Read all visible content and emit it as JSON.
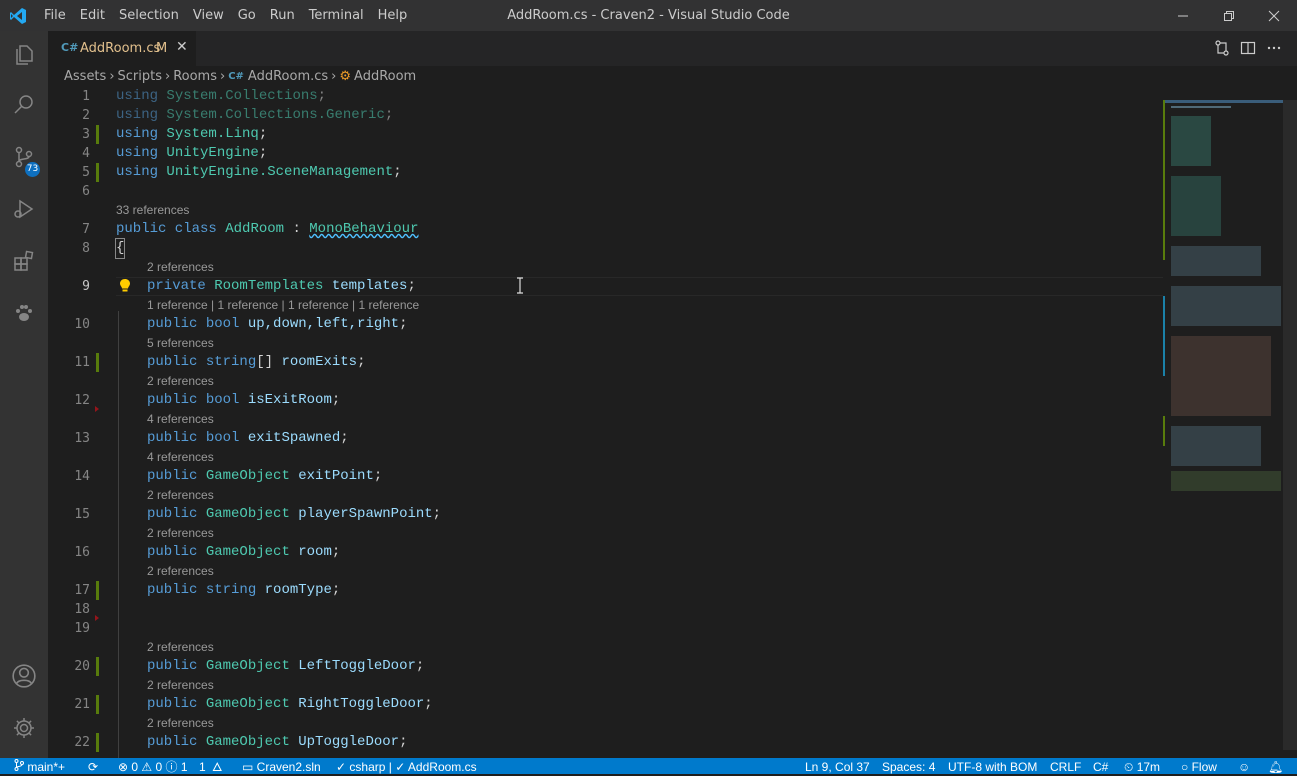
{
  "window": {
    "title": "AddRoom.cs - Craven2 - Visual Studio Code",
    "menu": [
      "File",
      "Edit",
      "Selection",
      "View",
      "Go",
      "Run",
      "Terminal",
      "Help"
    ]
  },
  "activity": {
    "scm_badge": "73"
  },
  "tab": {
    "icon": "C#",
    "name": "AddRoom.cs",
    "status": "M",
    "close": "✕"
  },
  "breadcrumb": {
    "parts": [
      "Assets",
      "Scripts",
      "Rooms",
      "AddRoom.cs",
      "AddRoom"
    ]
  },
  "editor": {
    "line_numbers": [
      "1",
      "2",
      "3",
      "4",
      "5",
      "6",
      "7",
      "8",
      "9",
      "10",
      "11",
      "12",
      "13",
      "14",
      "15",
      "16",
      "17",
      "18",
      "19",
      "20",
      "21",
      "22"
    ],
    "lens": {
      "l7": "33 references",
      "l9": "2 references",
      "l10": "1 reference | 1 reference | 1 reference | 1 reference",
      "l11": "5 references",
      "l12": "2 references",
      "l13": "4 references",
      "l14": "4 references",
      "l15": "2 references",
      "l16": "2 references",
      "l17": "2 references",
      "l20": "2 references",
      "l21": "2 references",
      "l22": "2 references"
    }
  },
  "code": {
    "l1": {
      "kw": "using",
      "ns": "System.Collections",
      "end": ";"
    },
    "l2": {
      "kw": "using",
      "ns": "System.Collections.Generic",
      "end": ";"
    },
    "l3": {
      "kw": "using",
      "ns": "System.Linq",
      "end": ";"
    },
    "l4": {
      "kw": "using",
      "ns": "UnityEngine",
      "end": ";"
    },
    "l5": {
      "kw": "using",
      "ns": "UnityEngine.SceneManagement",
      "end": ";"
    },
    "l7": {
      "mods": "public class",
      "name": "AddRoom",
      "colon": " : ",
      "base": "MonoBehaviour"
    },
    "l8": {
      "brace": "{"
    },
    "l9": {
      "mod": "private",
      "type": "RoomTemplates",
      "name": "templates",
      "end": ";"
    },
    "l10": {
      "mod": "public",
      "type": "bool",
      "name": "up,down,left,right",
      "end": ";"
    },
    "l11": {
      "mod": "public",
      "type": "string",
      "arr": "[]",
      "name": "roomExits",
      "end": ";"
    },
    "l12": {
      "mod": "public",
      "type": "bool",
      "name": "isExitRoom",
      "end": ";"
    },
    "l13": {
      "mod": "public",
      "type": "bool",
      "name": "exitSpawned",
      "end": ";"
    },
    "l14": {
      "mod": "public",
      "type": "GameObject",
      "name": "exitPoint",
      "end": ";"
    },
    "l15": {
      "mod": "public",
      "type": "GameObject",
      "name": "playerSpawnPoint",
      "end": ";"
    },
    "l16": {
      "mod": "public",
      "type": "GameObject",
      "name": "room",
      "end": ";"
    },
    "l17": {
      "mod": "public",
      "type": "string",
      "name": "roomType",
      "end": ";"
    },
    "l20": {
      "mod": "public",
      "type": "GameObject",
      "name": "LeftToggleDoor",
      "end": ";"
    },
    "l21": {
      "mod": "public",
      "type": "GameObject",
      "name": "RightToggleDoor",
      "end": ";"
    },
    "l22": {
      "mod": "public",
      "type": "GameObject",
      "name": "UpToggleDoor",
      "end": ";"
    }
  },
  "status": {
    "branch": "main*+",
    "errors": "0",
    "warnings": "0",
    "infos": "1",
    "info2": "1",
    "solution": "Craven2.sln",
    "omnisharp": "csharp | ✓ AddRoom.cs",
    "position": "Ln 9, Col 37",
    "spaces": "Spaces: 4",
    "encoding": "UTF-8 with BOM",
    "eol": "CRLF",
    "language": "C#",
    "time": "17m",
    "flow": "Flow"
  },
  "colors": {
    "accent": "#007acc",
    "keyword": "#569cd6",
    "type": "#4ec9b0",
    "identifier": "#9cdcfe",
    "modified": "#e2c08d"
  }
}
